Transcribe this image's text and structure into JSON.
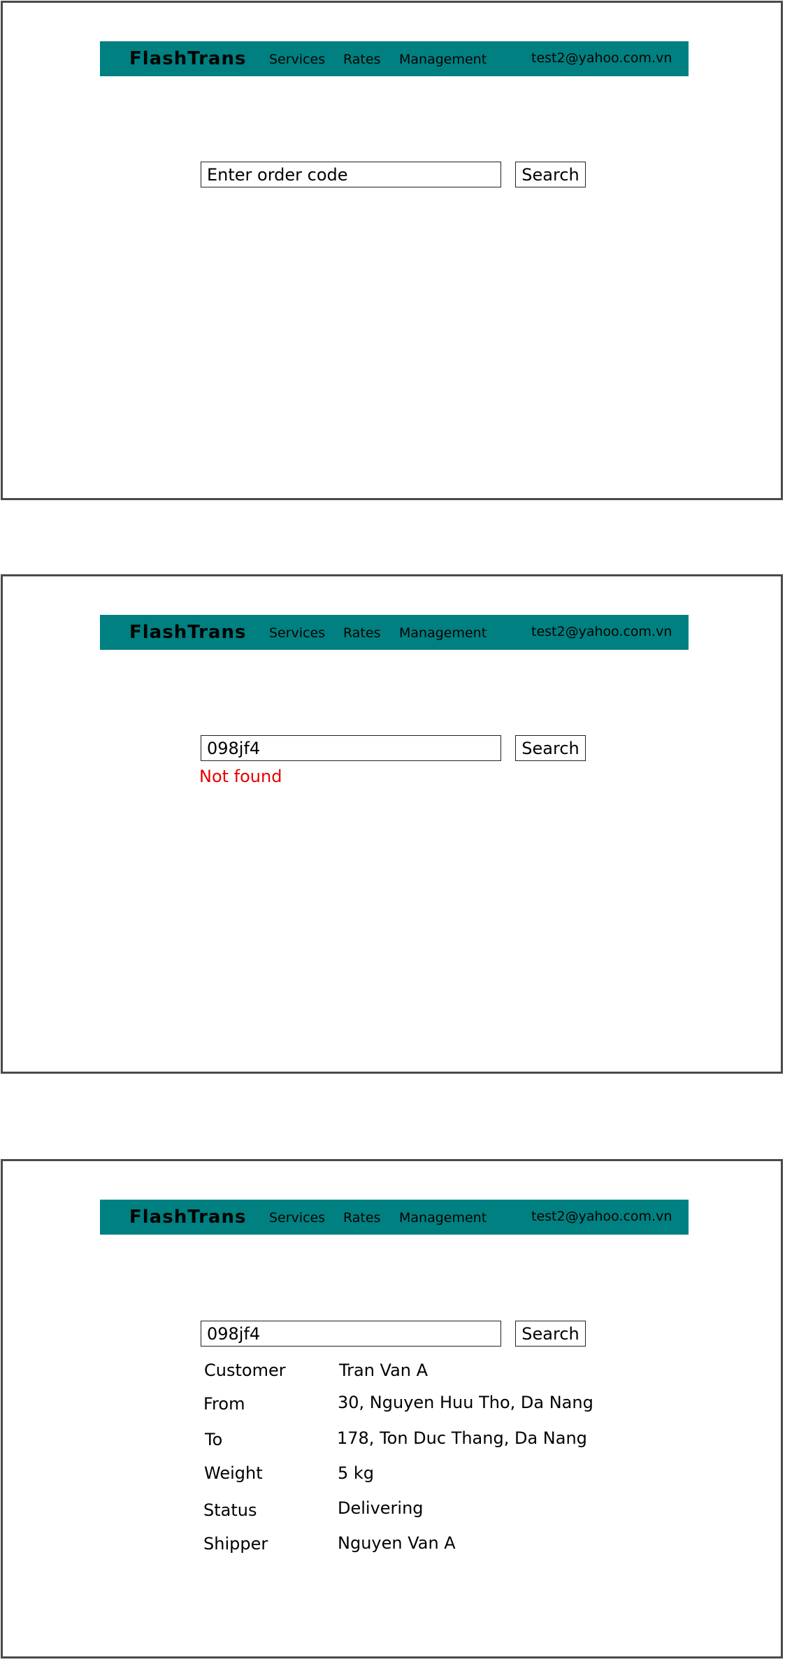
{
  "navbar": {
    "brand": "FlashTrans",
    "links": [
      "Services",
      "Rates",
      "Management"
    ],
    "user_email": "test2@yahoo.com.vn",
    "background_color": "#008080"
  },
  "search": {
    "placeholder": "Enter order code",
    "button_label": "Search"
  },
  "screens": [
    {
      "input_value": ""
    },
    {
      "input_value": "098jf4",
      "error_message": "Not found",
      "error_color": "#e60000"
    },
    {
      "input_value": "098jf4",
      "details": [
        {
          "label": "Customer",
          "value": "Tran Van A"
        },
        {
          "label": "From",
          "value": "30, Nguyen Huu Tho, Da Nang"
        },
        {
          "label": "To",
          "value": "178, Ton Duc Thang, Da Nang"
        },
        {
          "label": "Weight",
          "value": "5 kg"
        },
        {
          "label": "Status",
          "value": "Delivering"
        },
        {
          "label": "Shipper",
          "value": "Nguyen Van A"
        }
      ]
    }
  ]
}
